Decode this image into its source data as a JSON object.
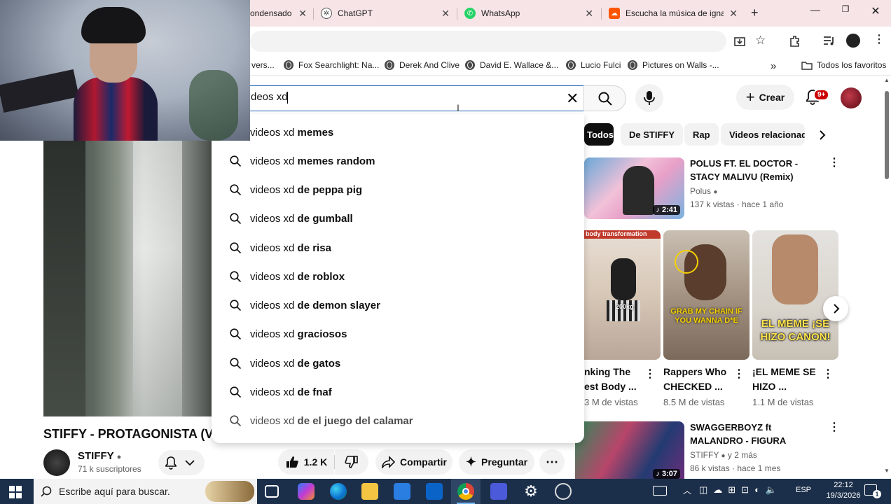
{
  "browser": {
    "tabs": [
      {
        "label": "ondensado",
        "favicon": "page-icon"
      },
      {
        "label": "ChatGPT",
        "favicon": "chatgpt-icon"
      },
      {
        "label": "WhatsApp",
        "favicon": "whatsapp-icon"
      },
      {
        "label": "Escucha la música de ignai",
        "favicon": "soundcloud-icon"
      }
    ],
    "bookmarks": [
      {
        "label": "vers..."
      },
      {
        "label": "Fox Searchlight: Na..."
      },
      {
        "label": "Derek And Clive"
      },
      {
        "label": "David E. Wallace &..."
      },
      {
        "label": "Lucio Fulci"
      },
      {
        "label": "Pictures on Walls -..."
      }
    ],
    "bookmarks_folder": "Todos los favoritos"
  },
  "youtube": {
    "search_value": "deos xd",
    "create_label": "Crear",
    "notification_badge": "9+",
    "suggestions": [
      {
        "prefix": "videos xd ",
        "suffix": "memes"
      },
      {
        "prefix": "videos xd ",
        "suffix": "memes random"
      },
      {
        "prefix": "videos xd ",
        "suffix": "de peppa pig"
      },
      {
        "prefix": "videos xd ",
        "suffix": "de gumball"
      },
      {
        "prefix": "videos xd ",
        "suffix": "de risa"
      },
      {
        "prefix": "videos xd ",
        "suffix": "de roblox"
      },
      {
        "prefix": "videos xd ",
        "suffix": "de demon slayer"
      },
      {
        "prefix": "videos xd ",
        "suffix": "graciosos"
      },
      {
        "prefix": "videos xd ",
        "suffix": "de gatos"
      },
      {
        "prefix": "videos xd ",
        "suffix": "de fnaf"
      },
      {
        "prefix": "videos xd ",
        "suffix": "de el juego del calamar"
      }
    ],
    "video": {
      "title": "STIFFY - PROTAGONISTA (V...",
      "channel": "STIFFY",
      "subscribers": "71 k suscriptores",
      "likes": "1.2 K",
      "share_label": "Compartir",
      "ask_label": "Preguntar"
    },
    "chips": [
      "Todos",
      "De STIFFY",
      "Rap",
      "Videos relacionad"
    ],
    "recommended": [
      {
        "title": "POLUS FT. EL DOCTOR - STACY MALIVU (Remix) (Official Video)",
        "channel": "Polus",
        "meta": "137 k vistas · hace 1 año",
        "duration": "2:41"
      },
      {
        "title": "SWAGGERBOYZ ft MALANDRO - FIGURA PUBLICA (Video Oficial)",
        "channel": "STIFFY",
        "meta_extra": "y 2 más",
        "meta": "86 k vistas · hace 1 mes",
        "duration": "3:07"
      }
    ],
    "shorts": [
      {
        "title_l1": "nking The",
        "title_l2": "est Body ...",
        "views": "3 M de vistas",
        "overlay": "body transformation",
        "tag": "200kg"
      },
      {
        "title_l1": "Rappers Who",
        "title_l2": "CHECKED ...",
        "views": "8.5 M de vistas",
        "overlay": "GRAB MY CHAIN IF YOU WANNA D*E"
      },
      {
        "title_l1": "¡EL MEME SE",
        "title_l2": "HIZO ...",
        "views": "1.1 M de vistas",
        "overlay": "EL MEME ¡SE HIZO CANON!"
      }
    ]
  },
  "taskbar": {
    "search_placeholder": "Escribe aquí para buscar.",
    "lang": "ESP",
    "time": "22:12",
    "date": "19/3/2026",
    "notif_count": "1"
  },
  "colors": {
    "tabbar": "#f7e4e6",
    "search_border": "#1c62b9",
    "taskbar": "#1c2f4a",
    "badge": "#cc0000"
  }
}
